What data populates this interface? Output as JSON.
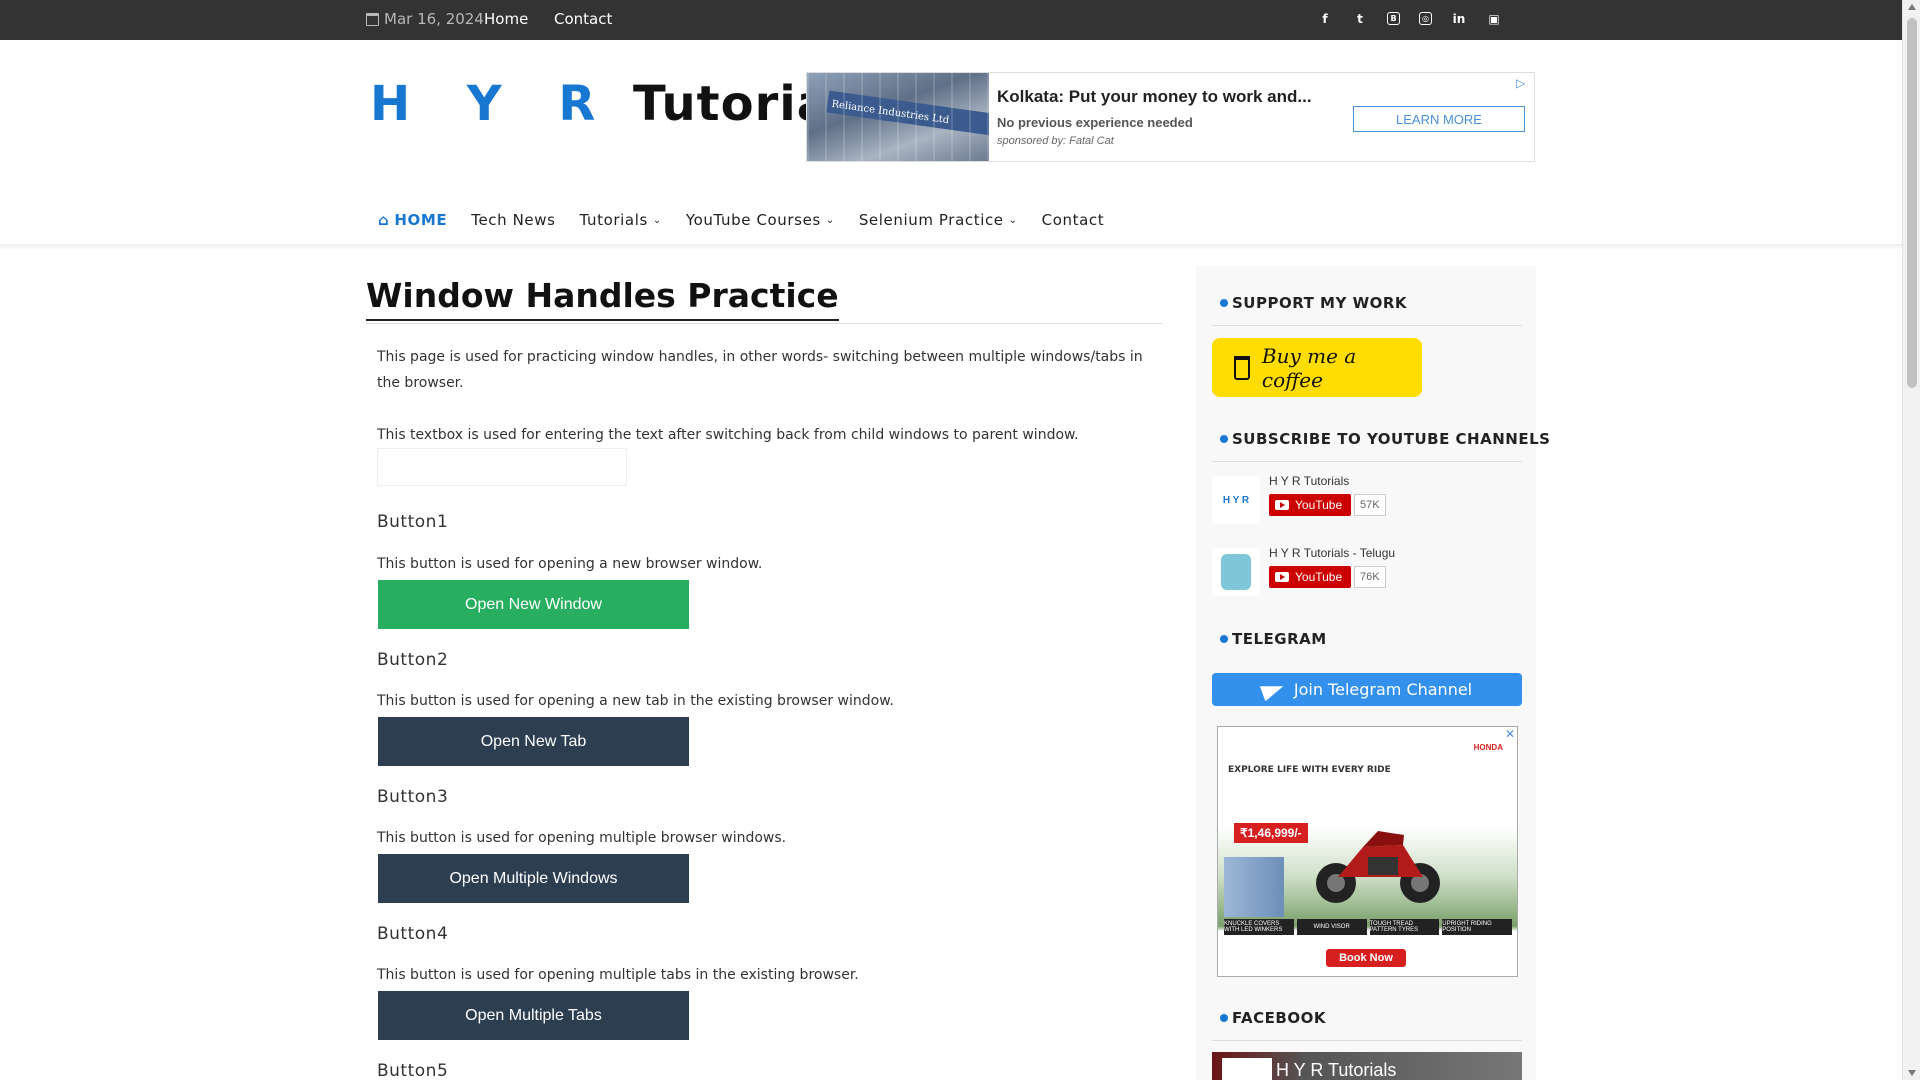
{
  "topbar": {
    "date": "Mar 16, 2024",
    "links": [
      "Home",
      "Contact"
    ],
    "social": [
      "facebook-icon",
      "twitter-icon",
      "blogger-icon",
      "instagram-icon",
      "linkedin-icon",
      "youtube-icon"
    ]
  },
  "header": {
    "logo_blue": "H Y R",
    "logo_dark": " Tutorials",
    "ad": {
      "headline": "Kolkata: Put your money to work and...",
      "sub": "No previous experience needed",
      "sponsor": "sponsored by: Fatal Cat",
      "cta": "LEARN MORE",
      "image_sign": "Reliance Industries Ltd"
    }
  },
  "nav": {
    "items": [
      {
        "label": "HOME"
      },
      {
        "label": "Tech News"
      },
      {
        "label": "Tutorials"
      },
      {
        "label": "YouTube Courses"
      },
      {
        "label": "Selenium Practice"
      },
      {
        "label": "Contact"
      }
    ]
  },
  "main": {
    "title": "Window Handles Practice",
    "intro": "This page is used for practicing window handles, in other words- switching between multiple windows/tabs in the browser.",
    "textbox_desc": "This textbox is used for entering the text after switching back from child windows to parent window.",
    "textbox_value": "",
    "buttons": [
      {
        "heading": "Button1",
        "desc": "This button is used for opening a new browser window.",
        "label": "Open New Window"
      },
      {
        "heading": "Button2",
        "desc": "This button is used for opening a new tab in the existing browser window.",
        "label": "Open New Tab"
      },
      {
        "heading": "Button3",
        "desc": "This button is used for opening multiple browser windows.",
        "label": "Open Multiple Windows"
      },
      {
        "heading": "Button4",
        "desc": "This button is used for opening multiple tabs in the existing browser.",
        "label": "Open Multiple Tabs"
      },
      {
        "heading": "Button5"
      }
    ]
  },
  "sidebar": {
    "support_heading": "SUPPORT MY WORK",
    "coffee_label": "Buy me a coffee",
    "subscribe_heading": "SUBSCRIBE TO YOUTUBE CHANNELS",
    "channels": [
      {
        "name": "H Y R Tutorials",
        "button": "YouTube",
        "count": "57K",
        "avatar": "H Y R"
      },
      {
        "name": "H Y R Tutorials - Telugu",
        "button": "YouTube",
        "count": "76K",
        "avatar": ""
      }
    ],
    "telegram_heading": "TELEGRAM",
    "telegram_label": "Join Telegram Channel",
    "ad2": {
      "tagline": "EXPLORE LIFE WITH EVERY RIDE",
      "price": "₹1,46,999/-",
      "features": [
        "KNUCKLE COVERS WITH LED WINKERS",
        "WIND VISOR",
        "TOUGH TREAD PATTERN TYRES",
        "UPRIGHT RIDING POSITION"
      ],
      "cta": "Book Now",
      "brand": "HONDA"
    },
    "facebook_heading": "FACEBOOK",
    "facebook_page": "H Y R Tutorials"
  },
  "colors": {
    "accent": "#1877d1",
    "green_button": "#27ae60",
    "dark_button": "#2c3e50",
    "topbar": "#333333",
    "coffee": "#ffdd00",
    "telegram": "#3390ec",
    "youtube": "#cc0000"
  }
}
